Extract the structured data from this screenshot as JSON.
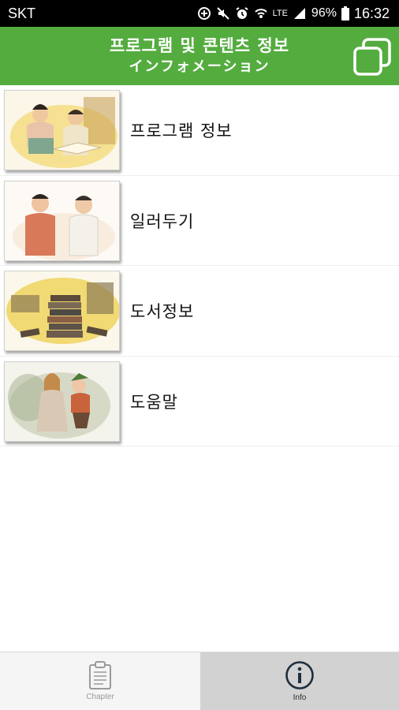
{
  "status_bar": {
    "carrier": "SKT",
    "network": "LTE",
    "battery": "96%",
    "time": "16:32"
  },
  "header": {
    "title_ko": "프로그램 및 콘텐츠 정보",
    "title_ja": "インフォメーション",
    "accent_color": "#54ac3f"
  },
  "menu": {
    "items": [
      {
        "label": "프로그램 정보",
        "thumbnail": "illustration-two-people-reading"
      },
      {
        "label": "일러두기",
        "thumbnail": "illustration-two-men-talking"
      },
      {
        "label": "도서정보",
        "thumbnail": "illustration-stacked-books"
      },
      {
        "label": "도움말",
        "thumbnail": "illustration-woman-and-kneeling-man"
      }
    ]
  },
  "bottom_nav": {
    "tabs": [
      {
        "label": "Chapter",
        "icon": "clipboard-icon",
        "selected": false
      },
      {
        "label": "Info",
        "icon": "info-circle-icon",
        "selected": true
      }
    ]
  }
}
